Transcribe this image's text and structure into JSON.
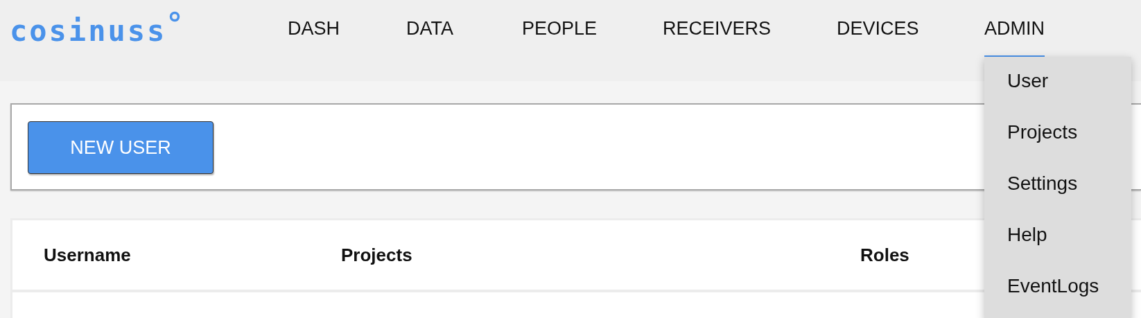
{
  "logo": {
    "text": "cosinuss"
  },
  "nav": [
    {
      "label": "DASH",
      "selected": false
    },
    {
      "label": "DATA",
      "selected": false
    },
    {
      "label": "PEOPLE",
      "selected": false
    },
    {
      "label": "RECEIVERS",
      "selected": false
    },
    {
      "label": "DEVICES",
      "selected": false
    },
    {
      "label": "ADMIN",
      "selected": true
    }
  ],
  "admin_menu": [
    "User",
    "Projects",
    "Settings",
    "Help",
    "EventLogs"
  ],
  "toolbar": {
    "button": "NEW USER"
  },
  "table": {
    "columns": [
      "Username",
      "Projects",
      "Roles"
    ]
  }
}
